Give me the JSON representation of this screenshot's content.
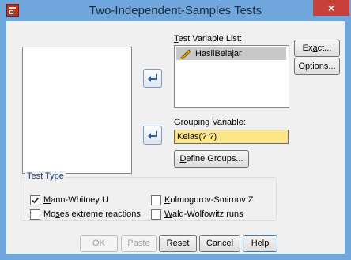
{
  "window": {
    "title": "Two-Independent-Samples Tests",
    "close_glyph": "×"
  },
  "test_variable": {
    "label_pre": "",
    "label_u": "T",
    "label_post": "est Variable List:",
    "items": [
      "HasilBelajar"
    ]
  },
  "grouping": {
    "label_u": "G",
    "label_post": "rouping Variable:",
    "value": "Kelas(? ?)"
  },
  "define_groups": {
    "label_u": "D",
    "label_post": "efine Groups..."
  },
  "exact": {
    "label_pre": "Ex",
    "label_u": "a",
    "label_post": "ct..."
  },
  "options": {
    "label_u": "O",
    "label_post": "ptions..."
  },
  "test_type": {
    "legend": "Test Type",
    "mann_whitney": {
      "label_u": "M",
      "label_post": "ann-Whitney U",
      "checked": true
    },
    "kolmogorov": {
      "label_u": "K",
      "label_post": "olmogorov-Smirnov Z",
      "checked": false
    },
    "moses": {
      "label_pre": "Mo",
      "label_u": "s",
      "label_post": "es extreme reactions",
      "checked": false
    },
    "wald": {
      "label_u": "W",
      "label_post": "ald-Wolfowitz runs",
      "checked": false
    }
  },
  "footer": {
    "ok": "OK",
    "paste_u": "P",
    "paste_post": "aste",
    "reset_u": "R",
    "reset_post": "eset",
    "cancel": "Cancel",
    "help": "Help"
  },
  "icons": {
    "app": "dialog-app-icon",
    "move_arrow": "move-arrow-icon",
    "variable": "scale-variable-icon",
    "check": "checkmark-icon"
  },
  "colors": {
    "titlebar": "#6fa6dc",
    "close": "#c9403a",
    "grouping_field": "#fde68a",
    "selected_item": "#c8c8c8"
  }
}
